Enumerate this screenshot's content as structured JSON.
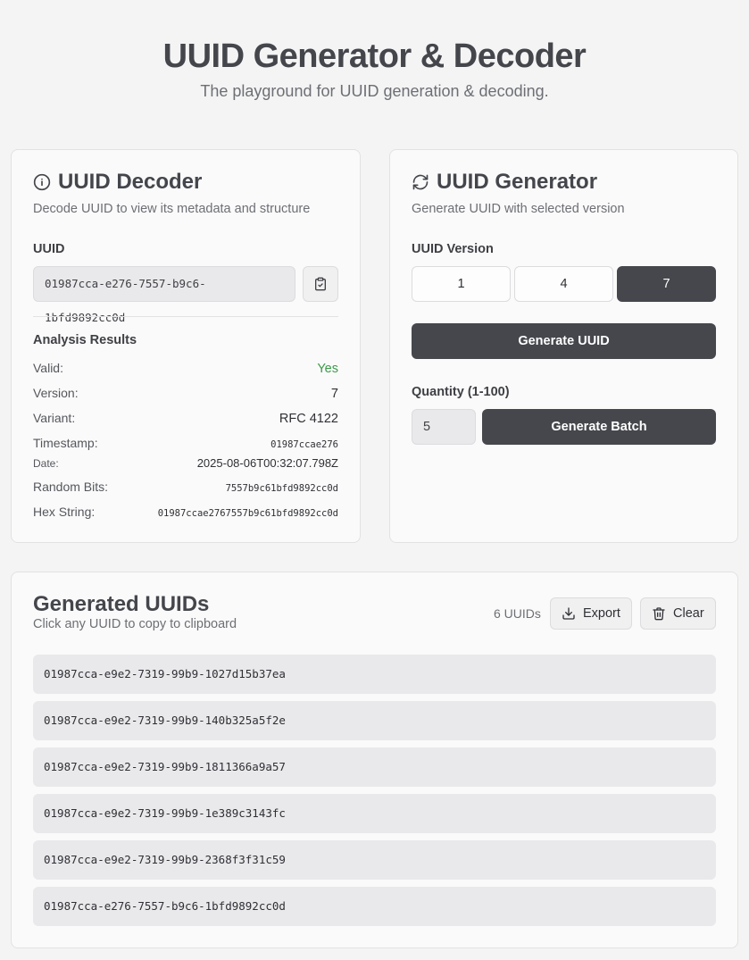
{
  "header": {
    "title": "UUID Generator & Decoder",
    "subtitle": "The playground for UUID generation & decoding."
  },
  "decoder": {
    "title": "UUID Decoder",
    "subtitle": "Decode UUID to view its metadata and structure",
    "icon": "info-icon",
    "uuid_label": "UUID",
    "uuid_value": "01987cca-e276-7557-b9c6-1bfd9892cc0d",
    "copy_icon": "clipboard-icon",
    "results_title": "Analysis Results",
    "results": {
      "valid_label": "Valid:",
      "valid_value": "Yes",
      "version_label": "Version:",
      "version_value": "7",
      "variant_label": "Variant:",
      "variant_value": "RFC 4122",
      "timestamp_label": "Timestamp:",
      "timestamp_value": "01987ccae276",
      "date_label": "Date:",
      "date_value": "2025-08-06T00:32:07.798Z",
      "random_label": "Random Bits:",
      "random_value": "7557b9c61bfd9892cc0d",
      "hex_label": "Hex String:",
      "hex_value": "01987ccae2767557b9c61bfd9892cc0d"
    },
    "valid_color": "#3c9a4a"
  },
  "generator": {
    "title": "UUID Generator",
    "subtitle": "Generate UUID with selected version",
    "icon": "refresh-icon",
    "version_label": "UUID Version",
    "versions": [
      "1",
      "4",
      "7"
    ],
    "selected_version": "7",
    "generate_label": "Generate UUID",
    "quantity_label": "Quantity (1-100)",
    "quantity_value": "5",
    "batch_label": "Generate Batch"
  },
  "generated": {
    "title": "Generated UUIDs",
    "subtitle": "Click any UUID to copy to clipboard",
    "count_text": "6 UUIDs",
    "export_label": "Export",
    "clear_label": "Clear",
    "items": [
      "01987cca-e9e2-7319-99b9-1027d15b37ea",
      "01987cca-e9e2-7319-99b9-140b325a5f2e",
      "01987cca-e9e2-7319-99b9-1811366a9a57",
      "01987cca-e9e2-7319-99b9-1e389c3143fc",
      "01987cca-e9e2-7319-99b9-2368f3f31c59",
      "01987cca-e276-7557-b9c6-1bfd9892cc0d"
    ]
  },
  "colors": {
    "background": "#f4f4f4",
    "dark_button": "#45474c",
    "input_bg": "#e9e9eb"
  }
}
